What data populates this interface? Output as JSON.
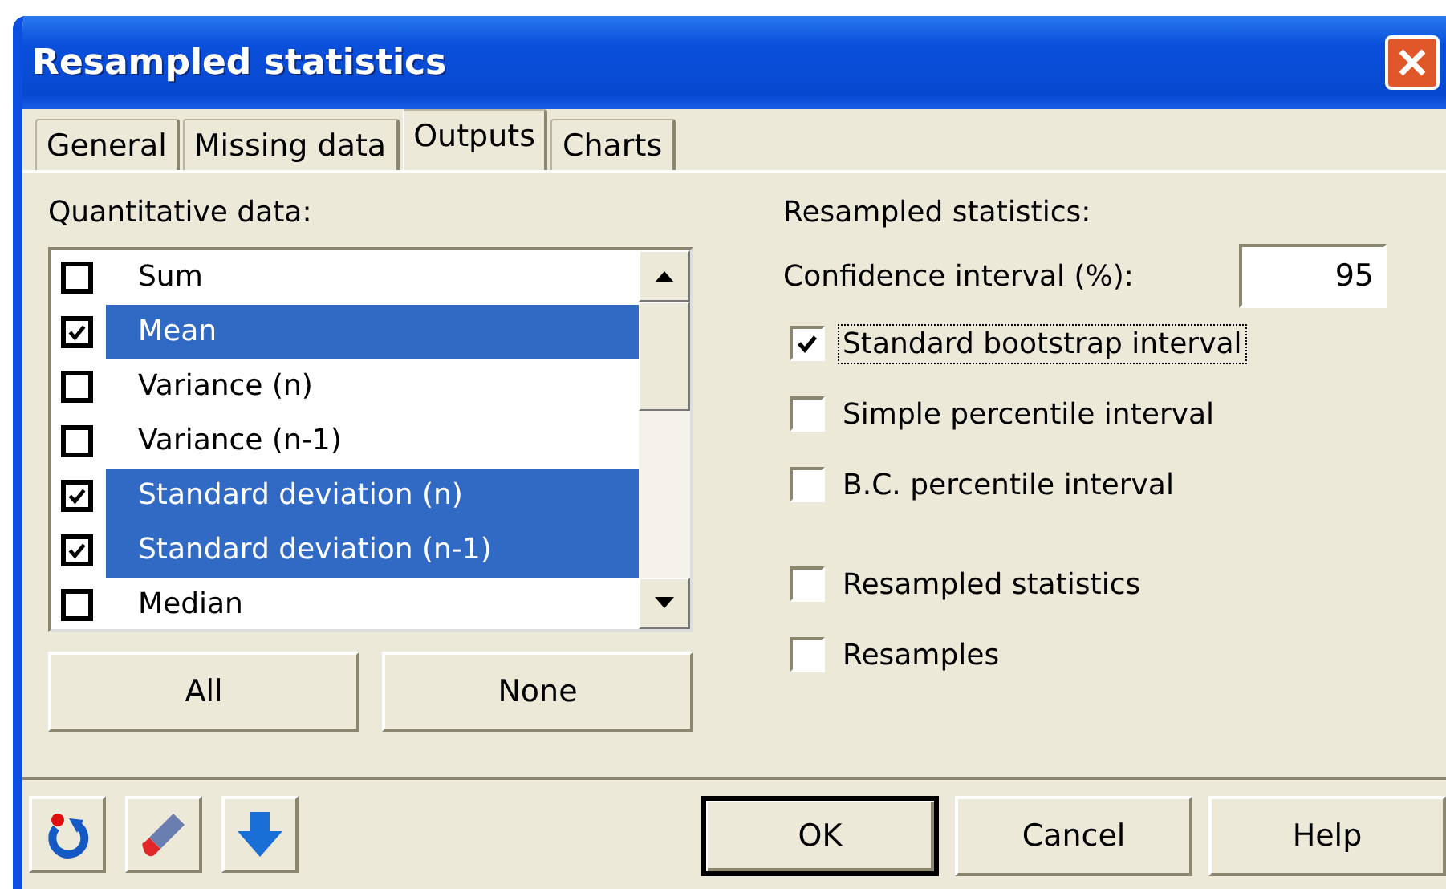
{
  "window": {
    "title": "Resampled statistics"
  },
  "tabs": [
    {
      "label": "General",
      "selected": false
    },
    {
      "label": "Missing data",
      "selected": false
    },
    {
      "label": "Outputs",
      "selected": true
    },
    {
      "label": "Charts",
      "selected": false
    }
  ],
  "quantitative": {
    "label": "Quantitative data:",
    "items": [
      {
        "label": "Sum",
        "checked": false,
        "selected": false
      },
      {
        "label": "Mean",
        "checked": true,
        "selected": true
      },
      {
        "label": "Variance (n)",
        "checked": false,
        "selected": false
      },
      {
        "label": "Variance (n-1)",
        "checked": false,
        "selected": false
      },
      {
        "label": "Standard deviation (n)",
        "checked": true,
        "selected": true
      },
      {
        "label": "Standard deviation (n-1)",
        "checked": true,
        "selected": true
      },
      {
        "label": "Median",
        "checked": false,
        "selected": false
      }
    ],
    "buttons": [
      "All",
      "None"
    ]
  },
  "resampled": {
    "heading": "Resampled statistics:",
    "confidence_label": "Confidence interval (%):",
    "confidence_value": "95",
    "interval_options": [
      {
        "label": "Standard bootstrap interval",
        "checked": true,
        "focused": true
      },
      {
        "label": "Simple percentile interval",
        "checked": false,
        "focused": false
      },
      {
        "label": "B.C. percentile interval",
        "checked": false,
        "focused": false
      }
    ],
    "output_options": [
      {
        "label": "Resampled statistics",
        "checked": false,
        "focused": false
      },
      {
        "label": "Resamples",
        "checked": false,
        "focused": false
      }
    ]
  },
  "toolbar": [
    {
      "kind": "reset"
    },
    {
      "kind": "eraser"
    },
    {
      "kind": "down"
    }
  ],
  "buttons": [
    {
      "label": "OK",
      "default": true
    },
    {
      "label": "Cancel",
      "default": false
    },
    {
      "label": "Help",
      "default": false
    }
  ]
}
